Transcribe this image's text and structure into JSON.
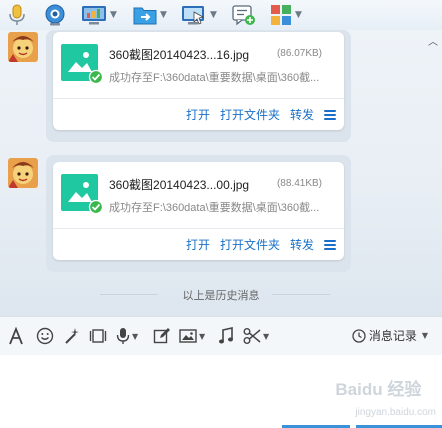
{
  "toolbar": {
    "buttons": [
      {
        "id": "voice",
        "icon": "microphone-icon",
        "dropdown": false
      },
      {
        "id": "video",
        "icon": "webcam-icon",
        "dropdown": false
      },
      {
        "id": "remote-desktop",
        "icon": "monitor-icon",
        "dropdown": true
      },
      {
        "id": "send-file",
        "icon": "folder-send-icon",
        "dropdown": true
      },
      {
        "id": "screen-share",
        "icon": "screen-share-icon",
        "dropdown": true
      },
      {
        "id": "create-discussion",
        "icon": "chat-add-icon",
        "dropdown": false
      },
      {
        "id": "apps",
        "icon": "app-grid-icon",
        "dropdown": true
      }
    ]
  },
  "messages": [
    {
      "file_name": "360截图20140423...16.jpg",
      "file_size": "(86.07KB)",
      "status": "成功存至F:\\360data\\重要数据\\桌面\\360截...",
      "actions": {
        "open": "打开",
        "open_folder": "打开文件夹",
        "forward": "转发"
      }
    },
    {
      "file_name": "360截图20140423...00.jpg",
      "file_size": "(88.41KB)",
      "status": "成功存至F:\\360data\\重要数据\\桌面\\360截...",
      "actions": {
        "open": "打开",
        "open_folder": "打开文件夹",
        "forward": "转发"
      }
    }
  ],
  "history_separator": "以上是历史消息",
  "format_toolbar": {
    "tools": [
      "font-icon",
      "emoji-icon",
      "magic-wand-icon",
      "video-message-icon",
      "voice-message-icon",
      "edit-icon",
      "image-icon",
      "music-icon",
      "scissors-icon"
    ],
    "history_label": "消息记录"
  },
  "watermark": {
    "logo": "Baidu 经验",
    "url": "jingyan.baidu.com"
  },
  "colors": {
    "link": "#1a70c8",
    "file_icon": "#1fc8a0",
    "check": "#3bb74c",
    "bubble": "#dbe3ec"
  }
}
